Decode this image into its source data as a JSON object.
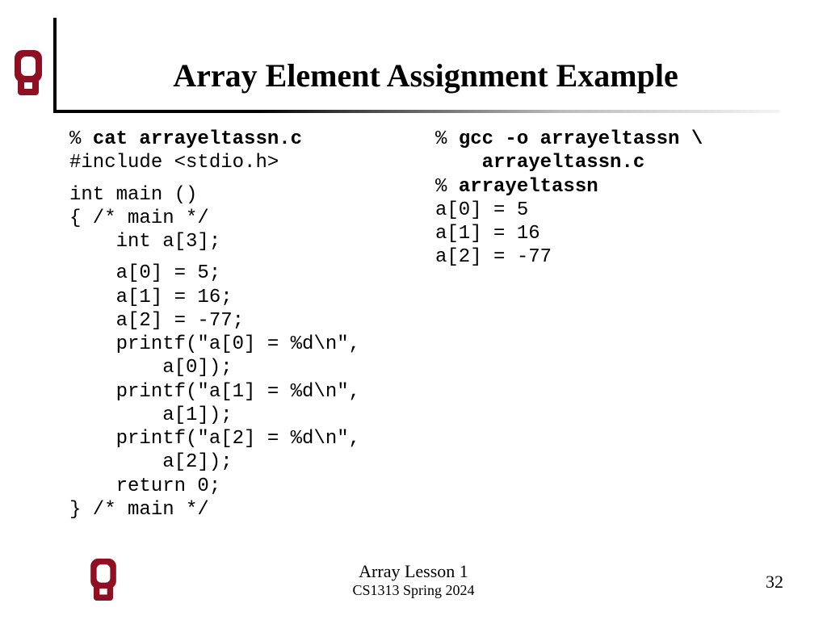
{
  "title": "Array Element Assignment Example",
  "left": {
    "l1a": "% ",
    "l1b": "cat arrayeltassn.c",
    "l2": "#include <stdio.h>",
    "l3": "int main ()",
    "l4": "{ /* main */",
    "l5": "    int a[3];",
    "l6": "    a[0] = 5;",
    "l7": "    a[1] = 16;",
    "l8": "    a[2] = -77;",
    "l9": "    printf(\"a[0] = %d\\n\",",
    "l10": "        a[0]);",
    "l11": "    printf(\"a[1] = %d\\n\",",
    "l12": "        a[1]);",
    "l13": "    printf(\"a[2] = %d\\n\",",
    "l14": "        a[2]);",
    "l15": "    return 0;",
    "l16": "} /* main */"
  },
  "right": {
    "r1a": "% ",
    "r1b": "gcc -o arrayeltassn \\",
    "r2": "    arrayeltassn.c",
    "r3a": "% ",
    "r3b": "arrayeltassn",
    "r4": "a[0] = 5",
    "r5": "a[1] = 16",
    "r6": "a[2] = -77"
  },
  "footer": {
    "line1": "Array Lesson 1",
    "line2": "CS1313 Spring 2024",
    "page": "32"
  },
  "colors": {
    "crimson": "#8e1022"
  }
}
